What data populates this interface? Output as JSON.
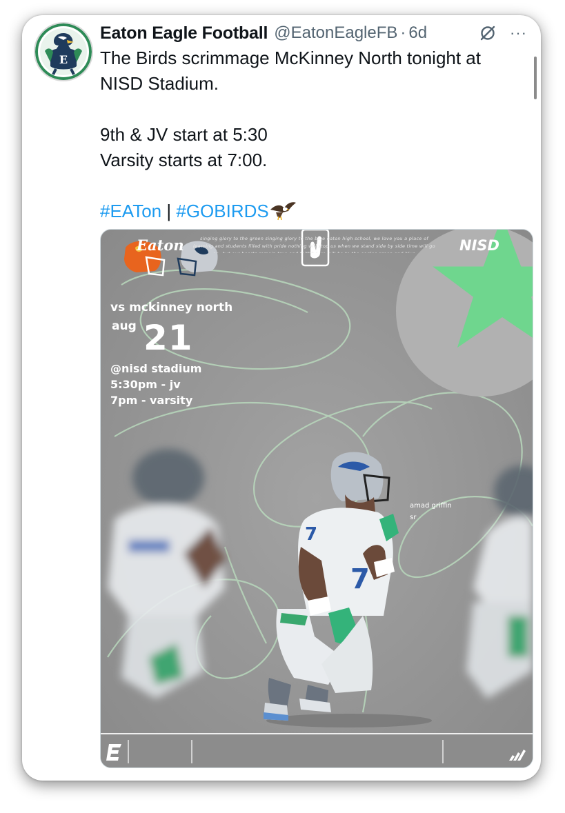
{
  "tweet": {
    "author_name": "Eaton Eagle Football",
    "handle": "@EatonEagleFB",
    "separator": "·",
    "time": "6d",
    "more_label": "···",
    "text_line1": "The Birds scrimmage McKinney North tonight at NISD Stadium.",
    "text_line2": "9th & JV start at 5:30",
    "text_line3": "Varsity starts at 7:00.",
    "hashtag1": "#EATon",
    "hashtag_separator": "|",
    "hashtag2": "#GOBIRDS",
    "emoji": "eagle-emoji",
    "link_color": "#1d9bf0"
  },
  "poster": {
    "opponent": "vs mckinney north",
    "month": "aug",
    "day": "21",
    "venue": "@nisd stadium",
    "jv_time": "5:30pm - jv",
    "varsity_time": "7pm - varsity",
    "player_name": "amad griffin",
    "player_class": "sr",
    "jersey_number": "7",
    "footer_brand": "Eaton",
    "footer_lyric": "singing glory to the green singing glory to the blue eaton high school, we love you a place of learning and students filled with pride nothing will stop us when we stand side by side time will go on, but our hearts remain true and faithful we will be to the eagles green and blue",
    "footer_district": "NISD",
    "accent_green": "#6fd68e"
  }
}
